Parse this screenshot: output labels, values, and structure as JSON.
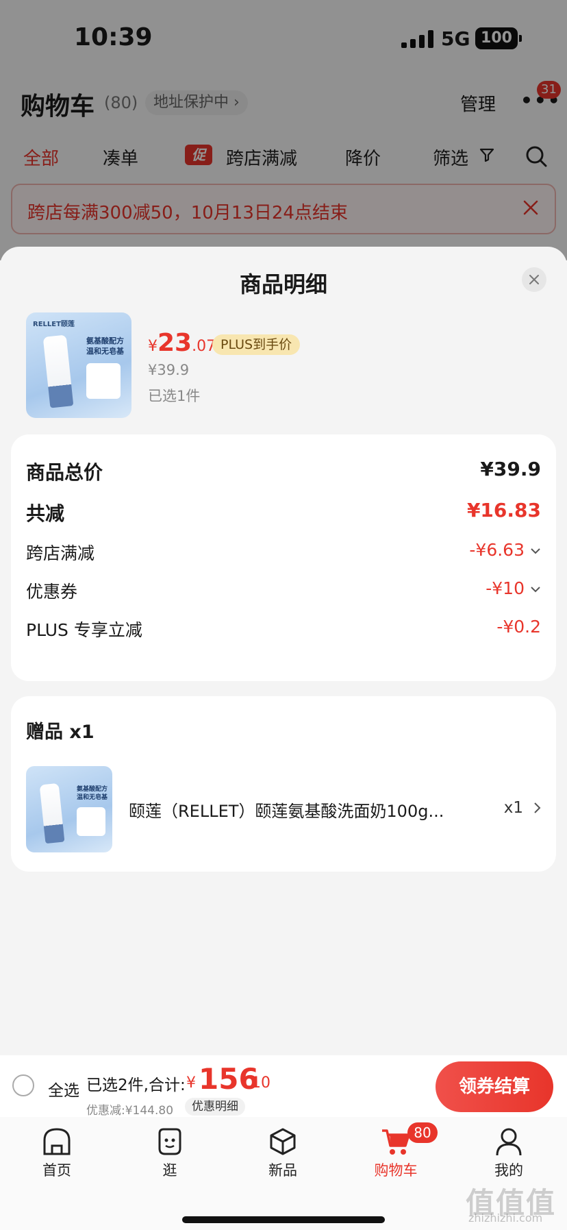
{
  "status_bar": {
    "time": "10:39",
    "network": "5G",
    "battery": "100"
  },
  "cart": {
    "title": "购物车",
    "count": "(80)",
    "address_protect": "地址保护中 ›",
    "manage": "管理",
    "more_badge": "31"
  },
  "tabs": {
    "all": "全部",
    "combine": "凑单",
    "promo_badge": "促",
    "cross_store": "跨店满减",
    "price_drop": "降价",
    "filter": "筛选"
  },
  "promo_banner": {
    "text": "跨店每满300减50，10月13日24点结束"
  },
  "sheet": {
    "title": "商品明细",
    "product": {
      "thumb_brand": "RELLET颐莲",
      "thumb_tag": "氨基酸配方 温和无皂基",
      "price_symbol": "¥",
      "price_int": "23",
      "price_dec": ".07",
      "plus_tag": "PLUS到手价",
      "original_price": "¥39.9",
      "selected": "已选1件"
    },
    "summary": [
      {
        "label": "商品总价",
        "value": "¥39.9"
      },
      {
        "label": "共减",
        "value": "¥16.83"
      },
      {
        "label": "跨店满减",
        "value": "-¥6.63"
      },
      {
        "label": "优惠券",
        "value": "-¥10"
      },
      {
        "label": "PLUS 专享立减",
        "value": "-¥0.2"
      }
    ],
    "gift": {
      "title": "赠品 x1",
      "name": "颐莲（RELLET）颐莲氨基酸洗面奶100g...",
      "qty": "x1"
    }
  },
  "checkout": {
    "select_all": "全选",
    "selected_text": "已选2件,合计:",
    "total_symbol": "¥",
    "total_int": "156",
    "total_dec": ".10",
    "discount_text": "优惠减:¥144.80",
    "discount_detail": "优惠明细",
    "pay_button": "领券结算"
  },
  "tabbar": [
    {
      "label": "首页",
      "icon": "home-icon"
    },
    {
      "label": "逛",
      "icon": "discover-icon"
    },
    {
      "label": "新品",
      "icon": "new-products-icon"
    },
    {
      "label": "购物车",
      "icon": "cart-icon",
      "badge": "80"
    },
    {
      "label": "我的",
      "icon": "profile-icon"
    }
  ],
  "watermark": {
    "text": "值值值",
    "sub": "zhizhizhi.com"
  },
  "colors": {
    "accent": "#e8352b",
    "plus_tag_bg": "#f8e6b0"
  }
}
